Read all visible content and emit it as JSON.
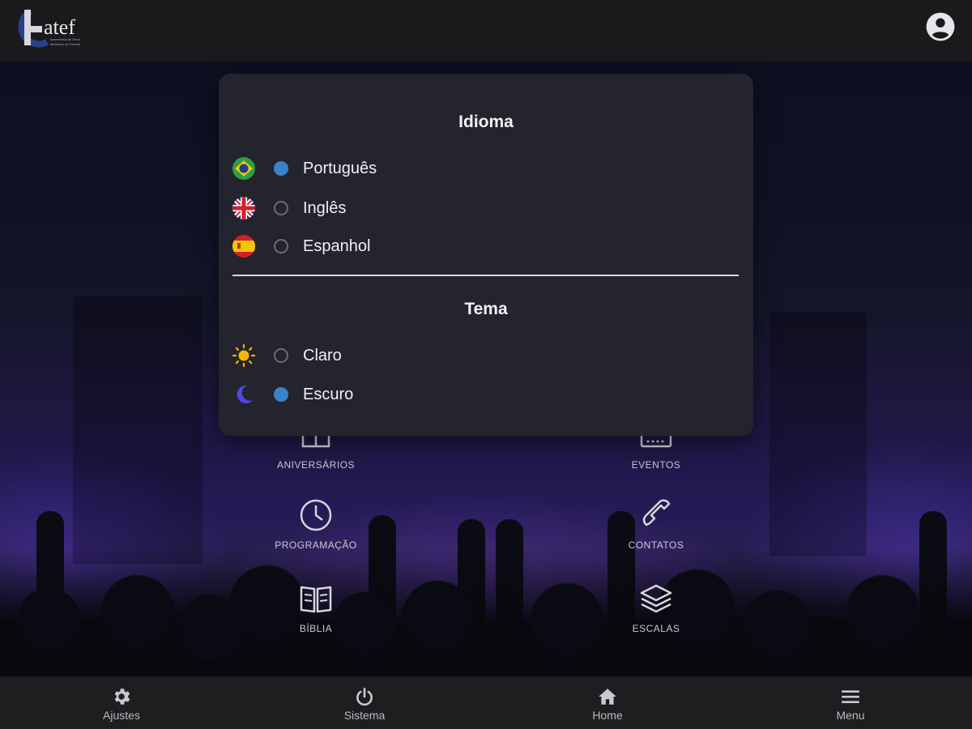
{
  "header": {
    "logo_text": "atef",
    "logo_subtitle_1": "Assembleia de Deus",
    "logo_subtitle_2": "Ministério de Família",
    "icons": {
      "logo": "catef-logo",
      "account": "account-circle-icon"
    }
  },
  "modal": {
    "language_title": "Idioma",
    "languages": [
      {
        "label": "Português",
        "icon": "brazil-flag-icon",
        "selected": true
      },
      {
        "label": "Inglês",
        "icon": "uk-flag-icon",
        "selected": false
      },
      {
        "label": "Espanhol",
        "icon": "spain-flag-icon",
        "selected": false
      }
    ],
    "theme_title": "Tema",
    "themes": [
      {
        "label": "Claro",
        "icon": "sun-icon",
        "selected": false
      },
      {
        "label": "Escuro",
        "icon": "moon-icon",
        "selected": true
      }
    ]
  },
  "grid": {
    "items": [
      {
        "label": "ANIVERSÁRIOS",
        "icon": "gift-icon"
      },
      {
        "label": "EVENTOS",
        "icon": "calendar-icon"
      },
      {
        "label": "PROGRAMAÇÃO",
        "icon": "clock-icon"
      },
      {
        "label": "CONTATOS",
        "icon": "phone-icon"
      },
      {
        "label": "BÍBLIA",
        "icon": "book-icon"
      },
      {
        "label": "ESCALAS",
        "icon": "layers-icon"
      }
    ]
  },
  "bottom_nav": {
    "items": [
      {
        "label": "Ajustes",
        "icon": "gear-icon"
      },
      {
        "label": "Sistema",
        "icon": "power-icon"
      },
      {
        "label": "Home",
        "icon": "home-icon"
      },
      {
        "label": "Menu",
        "icon": "hamburger-menu-icon"
      }
    ]
  },
  "colors": {
    "topbar": "#1a1a1c",
    "modal_bg": "#23242d",
    "radio_selected": "#3a83c9",
    "radio_unselected": "#6b6b73",
    "bottom_nav": "#1e1e20",
    "logo_blue": "#2a3f8f",
    "sun": "#f5b400",
    "moon": "#4f46e5"
  }
}
